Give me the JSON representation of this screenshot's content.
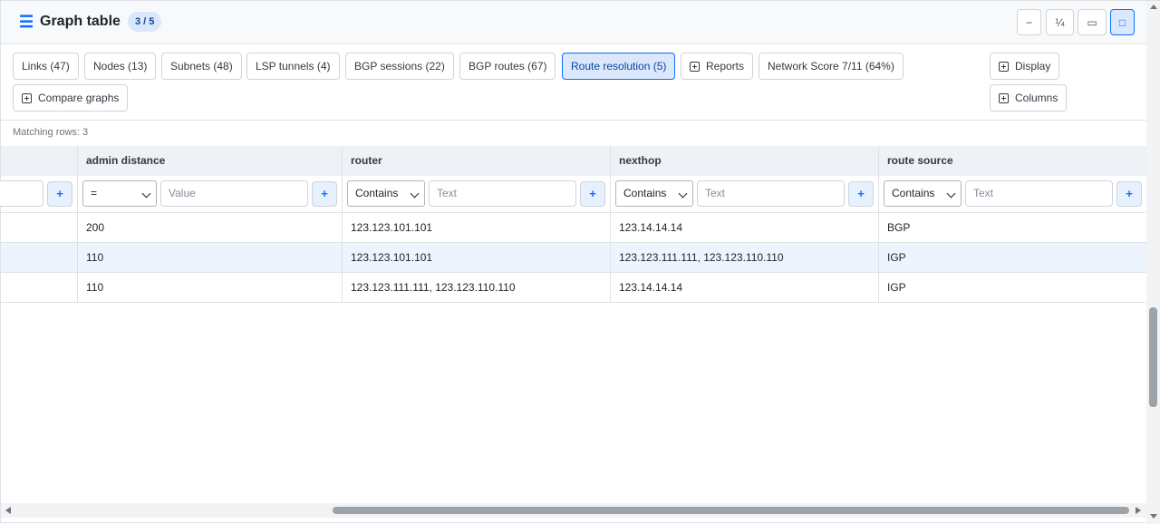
{
  "header": {
    "title": "Graph table",
    "count_badge": "3 / 5",
    "window_buttons": [
      "−",
      "¼",
      "▭",
      "□"
    ]
  },
  "tabs": [
    {
      "label": "Links (47)",
      "active": false
    },
    {
      "label": "Nodes (13)",
      "active": false
    },
    {
      "label": "Subnets (48)",
      "active": false
    },
    {
      "label": "LSP tunnels (4)",
      "active": false
    },
    {
      "label": "BGP sessions (22)",
      "active": false
    },
    {
      "label": "BGP routes (67)",
      "active": false
    },
    {
      "label": "Route resolution (5)",
      "active": true
    },
    {
      "label": "Reports",
      "active": false
    },
    {
      "label": "Network Score 7/11 (64%)",
      "active": false
    }
  ],
  "toolbar": {
    "compare_label": "Compare graphs",
    "display_label": "Display",
    "columns_label": "Columns"
  },
  "matching_rows": "Matching rows: 3",
  "columns": {
    "admin_distance": "admin distance",
    "router": "router",
    "nexthop": "nexthop",
    "route_source": "route source"
  },
  "filters": {
    "admin_distance_op": "=",
    "admin_distance_placeholder": "Value",
    "router_op": "Contains",
    "router_placeholder": "Text",
    "nexthop_op": "Contains",
    "nexthop_placeholder": "Text",
    "route_source_op": "Contains",
    "route_source_placeholder": "Text",
    "add_label": "+"
  },
  "rows": [
    {
      "admin_distance": "200",
      "router": "123.123.101.101",
      "nexthop": "123.14.14.14",
      "route_source": "BGP",
      "highlighted": false
    },
    {
      "admin_distance": "110",
      "router": "123.123.101.101",
      "nexthop": "123.123.111.111, 123.123.110.110",
      "route_source": "IGP",
      "highlighted": true
    },
    {
      "admin_distance": "110",
      "router": "123.123.111.111, 123.123.110.110",
      "nexthop": "123.14.14.14",
      "route_source": "IGP",
      "highlighted": false
    }
  ],
  "colors": {
    "accent": "#0d6efd",
    "active_tab_bg": "#dbe7fb",
    "row_highlight": "#eef4fd"
  }
}
